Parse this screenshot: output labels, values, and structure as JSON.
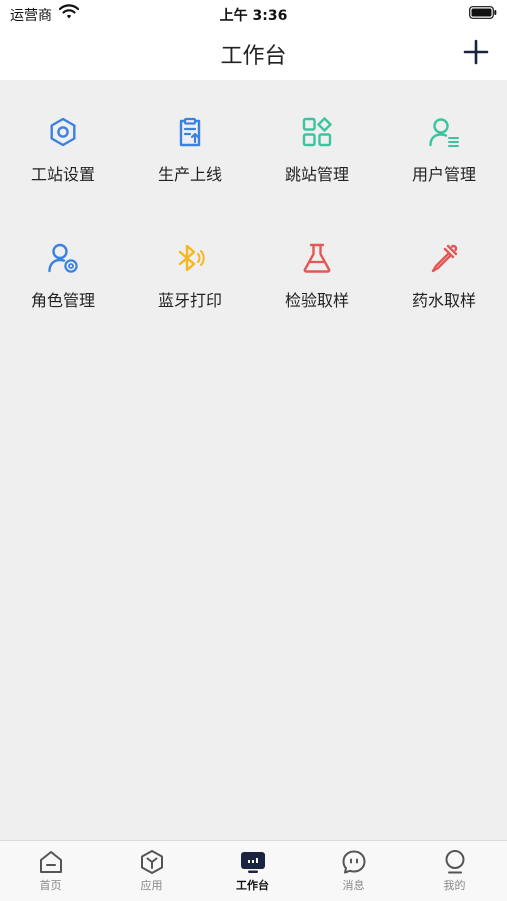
{
  "status_bar": {
    "carrier": "运营商",
    "time": "上午 3:36",
    "icons": [
      "wifi-icon",
      "battery-icon"
    ]
  },
  "nav": {
    "title": "工作台",
    "add_icon": "plus-icon"
  },
  "grid": {
    "items": [
      {
        "label": "工站设置",
        "icon": "gear-icon",
        "color": "#3b82e0"
      },
      {
        "label": "生产上线",
        "icon": "clipboard-upload-icon",
        "color": "#3b82e0"
      },
      {
        "label": "跳站管理",
        "icon": "apps-grid-icon",
        "color": "#3cc4a0"
      },
      {
        "label": "用户管理",
        "icon": "user-list-icon",
        "color": "#3cc4a0"
      },
      {
        "label": "角色管理",
        "icon": "user-settings-icon",
        "color": "#3b82e0"
      },
      {
        "label": "蓝牙打印",
        "icon": "bluetooth-icon",
        "color": "#f5b623"
      },
      {
        "label": "检验取样",
        "icon": "flask-icon",
        "color": "#e45757"
      },
      {
        "label": "药水取样",
        "icon": "dropper-icon",
        "color": "#e45757"
      }
    ]
  },
  "tab_bar": {
    "items": [
      {
        "label": "首页",
        "icon": "home-icon",
        "active": false
      },
      {
        "label": "应用",
        "icon": "cube-icon",
        "active": false
      },
      {
        "label": "工作台",
        "icon": "workbench-icon",
        "active": true
      },
      {
        "label": "消息",
        "icon": "chat-icon",
        "active": false
      },
      {
        "label": "我的",
        "icon": "profile-icon",
        "active": false
      }
    ]
  }
}
